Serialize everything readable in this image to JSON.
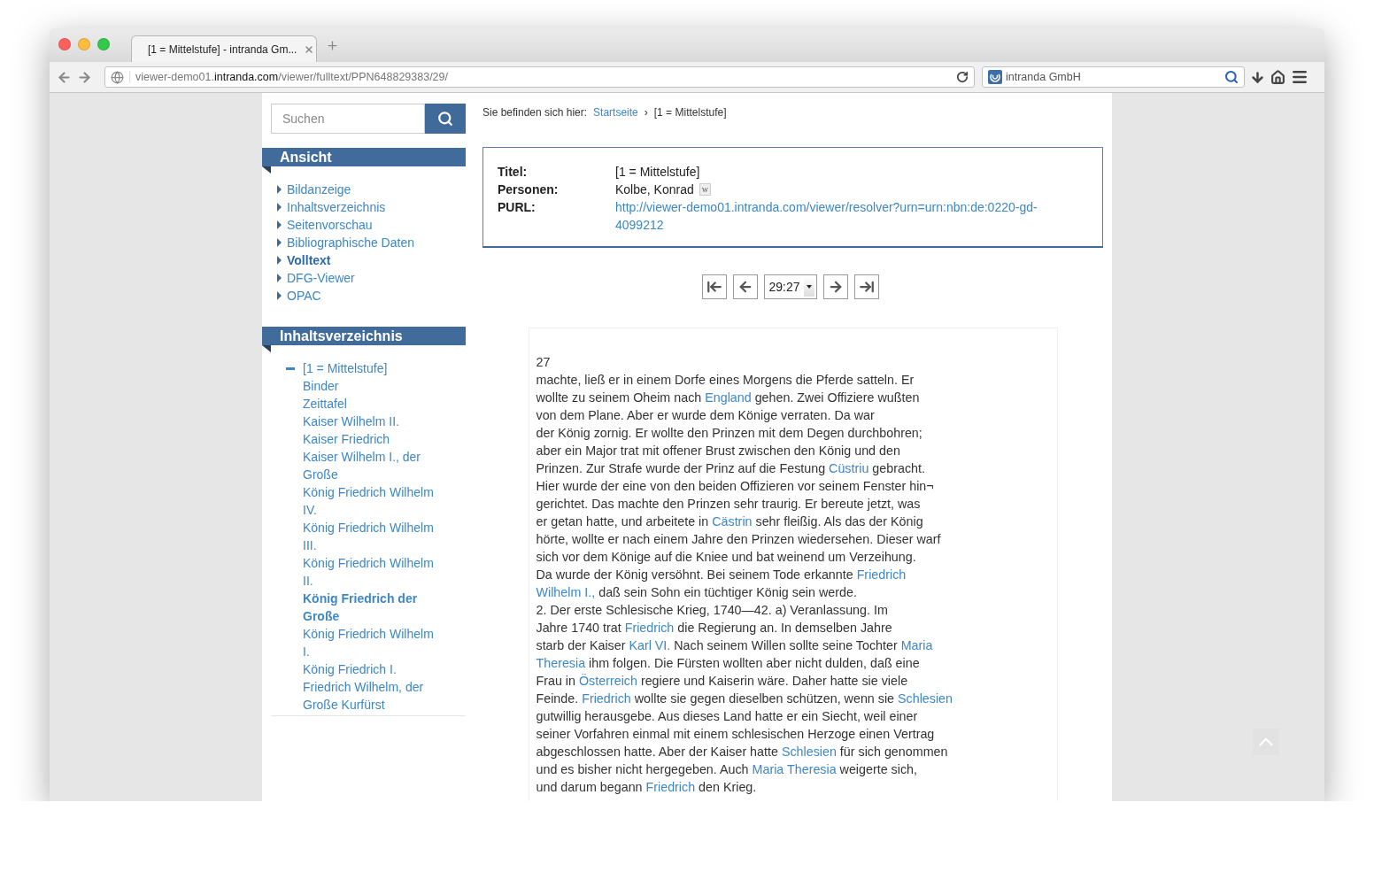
{
  "browser": {
    "tab": {
      "title": "[1 = Mittelstufe] - intranda Gm...",
      "selected": true
    },
    "url": "viewer-demo01.**intranda.com**/viewer/fulltext/PPN648829383/29/",
    "search_engine": "intranda GmbH"
  },
  "search": {
    "placeholder": "Suchen"
  },
  "breadcrumb": {
    "label": "Sie befinden sich hier:",
    "items": [
      "Startseite",
      "[1 = Mittelstufe]"
    ],
    "separator": "›"
  },
  "sidebar": {
    "view": {
      "title": "Ansicht",
      "items": [
        {
          "label": "Bildanzeige",
          "selected": false
        },
        {
          "label": "Inhaltsverzeichnis",
          "selected": false
        },
        {
          "label": "Seitenvorschau",
          "selected": false
        },
        {
          "label": "Bibliographische Daten",
          "selected": false
        },
        {
          "label": "Volltext",
          "selected": true
        },
        {
          "label": "DFG-Viewer",
          "selected": false
        },
        {
          "label": "OPAC",
          "selected": false
        }
      ]
    },
    "toc": {
      "title": "Inhaltsverzeichnis",
      "items": [
        {
          "label": "[1 = Mittelstufe]",
          "expanded": true,
          "selected": false,
          "children": [
            {
              "label": "Binder",
              "selected": false
            },
            {
              "label": "Zeittafel",
              "selected": false
            },
            {
              "label": "Kaiser Wilhelm II.",
              "selected": false
            },
            {
              "label": "Kaiser Friedrich",
              "selected": false
            },
            {
              "label": "Kaiser Wilhelm I., der Große",
              "selected": false
            },
            {
              "label": "König Friedrich Wilhelm IV.",
              "selected": false
            },
            {
              "label": "König Friedrich Wilhelm III.",
              "selected": false
            },
            {
              "label": "König Friedrich Wilhelm II.",
              "selected": false
            },
            {
              "label": "König Friedrich der Große",
              "selected": true
            },
            {
              "label": "König Friedrich Wilhelm I.",
              "selected": false
            },
            {
              "label": "König Friedrich I.",
              "selected": false
            },
            {
              "label": "Friedrich Wilhelm, der Große Kurfürst",
              "selected": false
            }
          ]
        }
      ]
    }
  },
  "metadata": [
    {
      "label": "Titel:",
      "value": "[1 = Mittelstufe]",
      "kind": "text"
    },
    {
      "label": "Personen:",
      "value": "Kolbe, Konrad",
      "kind": "person",
      "badge": "w"
    },
    {
      "label": "PURL:",
      "value": "http://viewer-demo01.intranda.com/viewer/resolver?urn=urn:nbn:de:0220-gd-4099212",
      "kind": "link"
    }
  ],
  "pager": {
    "page": "29:27"
  },
  "fulltext": {
    "page_number": "27",
    "lines": [
      [
        {
          "kind": "text",
          "text": "machte, ließ er in einem Dorfe eines Morgens die Pferde satteln. Er"
        }
      ],
      [
        {
          "kind": "text",
          "text": "wollte zu seinem Oheim nach "
        },
        {
          "kind": "link",
          "text": "England"
        },
        {
          "kind": "text",
          "text": " gehen. Zwei Offiziere wußten"
        }
      ],
      [
        {
          "kind": "text",
          "text": "von dem Plane. Aber er wurde dem Könige verraten. Da war"
        }
      ],
      [
        {
          "kind": "text",
          "text": "der König zornig. Er wollte den Prinzen mit dem Degen durchbohren;"
        }
      ],
      [
        {
          "kind": "text",
          "text": "aber ein Major trat mit offener Brust zwischen den König und den"
        }
      ],
      [
        {
          "kind": "text",
          "text": "Prinzen. Zur Strafe wurde der Prinz auf die Festung "
        },
        {
          "kind": "link",
          "text": "Cüstriu"
        },
        {
          "kind": "text",
          "text": " gebracht."
        }
      ],
      [
        {
          "kind": "text",
          "text": "Hier wurde der eine von den beiden Offizieren vor seinem Fenster hin¬"
        }
      ],
      [
        {
          "kind": "text",
          "text": "gerichtet. Das machte den Prinzen sehr traurig. Er bereute jetzt, was"
        }
      ],
      [
        {
          "kind": "text",
          "text": "er getan hatte, und arbeitete in "
        },
        {
          "kind": "link",
          "text": "Cästrin"
        },
        {
          "kind": "text",
          "text": " sehr fleißig. Als das der König"
        }
      ],
      [
        {
          "kind": "text",
          "text": "hörte, wollte er nach einem Jahre den Prinzen wiedersehen. Dieser warf"
        }
      ],
      [
        {
          "kind": "text",
          "text": "sich vor dem Könige auf die Kniee und bat weinend um Verzeihung."
        }
      ],
      [
        {
          "kind": "text",
          "text": "Da wurde der König versöhnt. Bei seinem Tode erkannte "
        },
        {
          "kind": "link",
          "text": "Friedrich"
        }
      ],
      [
        {
          "kind": "link",
          "text": "Wilhelm I.,"
        },
        {
          "kind": "text",
          "text": " daß sein Sohn ein tüchtiger König sein werde."
        }
      ],
      [
        {
          "kind": "text",
          "text": "2. Der erste Schlesische Krieg, 1740—42. a) Veranlassung. Im"
        }
      ],
      [
        {
          "kind": "text",
          "text": "Jahre 1740 trat "
        },
        {
          "kind": "link",
          "text": "Friedrich"
        },
        {
          "kind": "text",
          "text": " die Regierung an. In demselben Jahre"
        }
      ],
      [
        {
          "kind": "text",
          "text": "starb der Kaiser "
        },
        {
          "kind": "link",
          "text": "Karl VI."
        },
        {
          "kind": "text",
          "text": " Nach seinem Willen sollte seine Tochter "
        },
        {
          "kind": "link",
          "text": "Maria"
        }
      ],
      [
        {
          "kind": "link",
          "text": "Theresia"
        },
        {
          "kind": "text",
          "text": " ihm folgen. Die Fürsten wollten aber nicht dulden, daß eine"
        }
      ],
      [
        {
          "kind": "text",
          "text": "Frau in "
        },
        {
          "kind": "link",
          "text": "Österreich"
        },
        {
          "kind": "text",
          "text": " regiere und Kaiserin wäre. Daher hatte sie viele"
        }
      ],
      [
        {
          "kind": "text",
          "text": "Feinde. "
        },
        {
          "kind": "link",
          "text": "Friedrich"
        },
        {
          "kind": "text",
          "text": " wollte sie gegen dieselben schützen, wenn sie "
        },
        {
          "kind": "link",
          "text": "Schlesien"
        }
      ],
      [
        {
          "kind": "text",
          "text": "gutwillig herausgebe. Aus dieses Land hatte er ein Siecht, weil einer"
        }
      ],
      [
        {
          "kind": "text",
          "text": "seiner Vorfahren einmal mit einem schlesischen Herzoge einen Vertrag"
        }
      ],
      [
        {
          "kind": "text",
          "text": "abgeschlossen hatte. Aber der Kaiser hatte "
        },
        {
          "kind": "link",
          "text": "Schlesien"
        },
        {
          "kind": "text",
          "text": " für sich genommen"
        }
      ],
      [
        {
          "kind": "text",
          "text": "und es bisher nicht hergegeben. Auch "
        },
        {
          "kind": "link",
          "text": "Maria Theresia"
        },
        {
          "kind": "text",
          "text": " weigerte sich,"
        }
      ],
      [
        {
          "kind": "text",
          "text": "und darum begann "
        },
        {
          "kind": "link",
          "text": "Friedrich"
        },
        {
          "kind": "text",
          "text": " den Krieg."
        }
      ]
    ]
  }
}
